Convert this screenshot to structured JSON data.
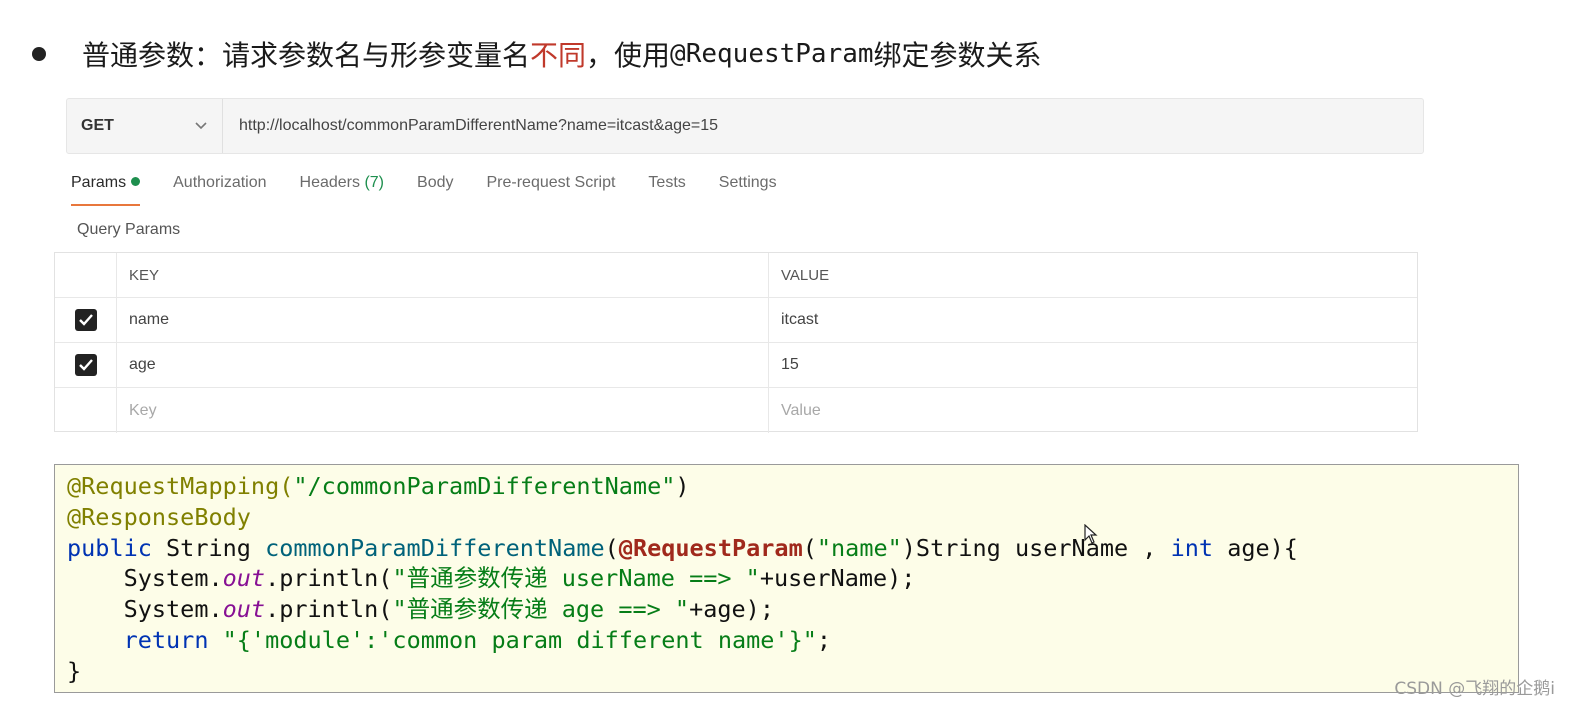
{
  "heading": {
    "part1": "普通参数：请求参数名与形参变量名",
    "emphasis": "不同",
    "part2": "，使用",
    "code": "@RequestParam",
    "part3": "绑定参数关系"
  },
  "request": {
    "method": "GET",
    "url": "http://localhost/commonParamDifferentName?name=itcast&age=15"
  },
  "tabs": [
    {
      "label": "Params",
      "active": true,
      "dot": true
    },
    {
      "label": "Authorization"
    },
    {
      "label": "Headers",
      "count": "(7)"
    },
    {
      "label": "Body"
    },
    {
      "label": "Pre-request Script"
    },
    {
      "label": "Tests"
    },
    {
      "label": "Settings"
    }
  ],
  "query_params": {
    "title": "Query Params",
    "headers": {
      "key": "KEY",
      "value": "VALUE"
    },
    "rows": [
      {
        "checked": true,
        "key": "name",
        "value": "itcast"
      },
      {
        "checked": true,
        "key": "age",
        "value": "15"
      }
    ],
    "placeholder": {
      "key": "Key",
      "value": "Value"
    }
  },
  "code": {
    "l1_ann": "@RequestMapping(",
    "l1_str": "\"/commonParamDifferentName\"",
    "l1_end": ")",
    "l2_ann": "@ResponseBody",
    "l3_kw1": "public",
    "l3_t1": " String ",
    "l3_fn": "commonParamDifferentName",
    "l3_t2": "(",
    "l3_ra": "@RequestParam",
    "l3_t3": "(",
    "l3_str": "\"name\"",
    "l3_t4": ")String userName , ",
    "l3_kw2": "int",
    "l3_t5": " age){",
    "l4_a": "    System.",
    "l4_out": "out",
    "l4_b": ".println(",
    "l4_str": "\"普通参数传递 userName ==> \"",
    "l4_c": "+userName);",
    "l5_a": "    System.",
    "l5_out": "out",
    "l5_b": ".println(",
    "l5_str": "\"普通参数传递 age ==> \"",
    "l5_c": "+age);",
    "l6_a": "    ",
    "l6_kw": "return",
    "l6_sp": " ",
    "l6_str": "\"{'module':'common param different name'}\"",
    "l6_c": ";",
    "l7": "}"
  },
  "watermark": "CSDN @飞翔的企鹅i",
  "colors": {
    "accent": "#e8773c",
    "dot_green": "#1e8f4e",
    "emphasis_red": "#c0392b"
  }
}
